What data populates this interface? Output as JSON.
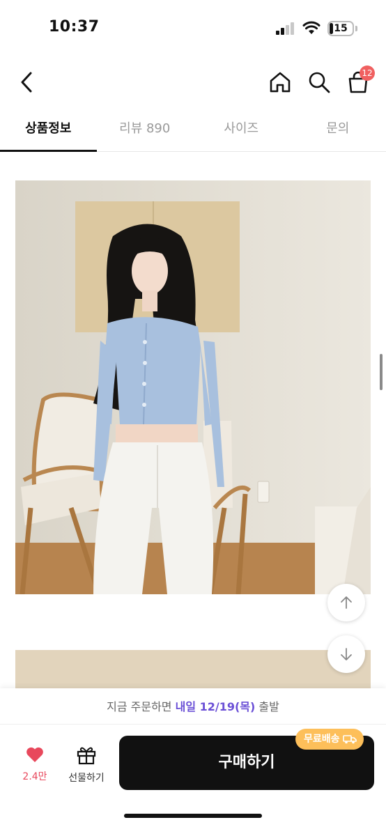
{
  "status_bar": {
    "time": "10:37",
    "battery": "15",
    "battery_level": 0.15
  },
  "nav": {
    "cart_count": "12"
  },
  "tabs": [
    {
      "label": "상품정보",
      "active": true
    },
    {
      "label": "리뷰 890",
      "active": false
    },
    {
      "label": "사이즈",
      "active": false
    },
    {
      "label": "문의",
      "active": false
    }
  ],
  "delivery": {
    "prefix": "지금 주문하면 ",
    "highlight": "내일 12/19(목)",
    "suffix": " 출발"
  },
  "actions": {
    "like_count": "2.4만",
    "gift_label": "선물하기",
    "buy_label": "구매하기",
    "free_shipping_label": "무료배송"
  },
  "colors": {
    "accent": "#6a4fd6",
    "like": "#e8485c",
    "badge": "#f06060",
    "free_ship": "#fdbf5a",
    "buy_button": "#111111"
  }
}
